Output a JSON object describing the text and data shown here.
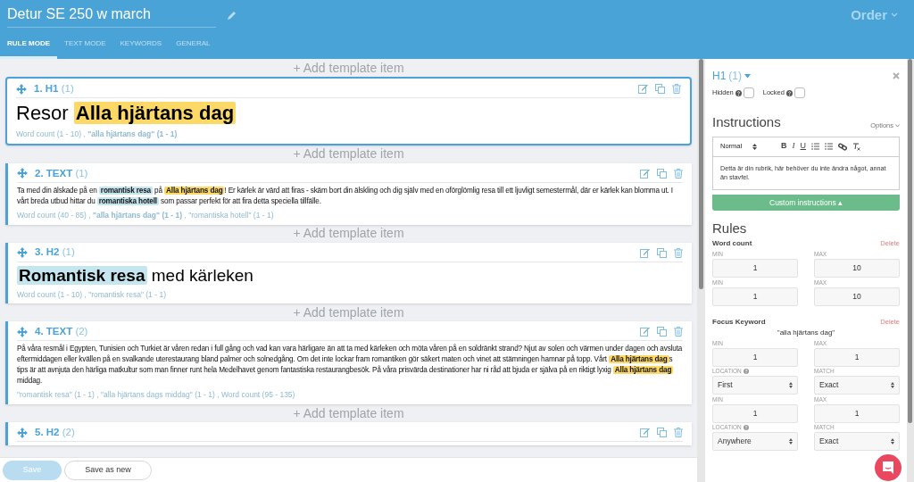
{
  "header": {
    "title": "Detur SE 250 w march",
    "menu": "Order"
  },
  "tabs": [
    {
      "label": "RULE MODE",
      "selected": true
    },
    {
      "label": "TEXT MODE",
      "selected": false
    },
    {
      "label": "KEYWORDS",
      "selected": false
    },
    {
      "label": "GENERAL",
      "selected": false
    }
  ],
  "items": [
    {
      "add_label": "+ Add template item",
      "title": "1. H1",
      "count": "(1)",
      "kind": "h1",
      "selected": true,
      "content": [
        {
          "kind": "plain",
          "text": "Resor "
        },
        {
          "kind": "focus",
          "text": "Alla hjärtans dag"
        }
      ],
      "meta": "Word count (1 - 10) , **\"alla hjärtans dag\" (1 - 1)**"
    },
    {
      "add_label": "+ Add template item",
      "title": "2. TEXT",
      "count": "(1)",
      "kind": "text",
      "selected": false,
      "content": [
        {
          "kind": "plain",
          "text": "Ta med din älskade på en "
        },
        {
          "kind": "keyword",
          "text": "romantisk resa"
        },
        {
          "kind": "plain",
          "text": " på "
        },
        {
          "kind": "focus",
          "text": "Alla hjärtans dag"
        },
        {
          "kind": "plain",
          "text": "! Er kärlek är värd att firas - skäm bort din älskling och dig själv med en oförglömlig resa till ett ljuvligt semestermål, där er kärlek kan blomma ut. I vårt breda utbud hittar du "
        },
        {
          "kind": "keyword",
          "text": "romantiska hotell"
        },
        {
          "kind": "plain",
          "text": " som passar perfekt för att fira detta speciella tillfälle."
        }
      ],
      "meta": "Word count (40 - 85) , **\"alla hjärtans dag\" (1 - 1)** , \"romantiska hotell\" (1 - 1)"
    },
    {
      "add_label": "+ Add template item",
      "title": "3. H2",
      "count": "(1)",
      "kind": "h2",
      "selected": false,
      "content": [
        {
          "kind": "keyword",
          "text": "Romantisk resa"
        },
        {
          "kind": "plain",
          "text": " med kärleken"
        }
      ],
      "meta": "Word count (1 - 10) , \"romantisk resa\" (1 - 1)"
    },
    {
      "add_label": "+ Add template item",
      "title": "4. TEXT",
      "count": "(2)",
      "kind": "text",
      "selected": false,
      "content": [
        {
          "kind": "plain",
          "text": "På våra resmål i Egypten, Tunisien och Turkiet är våren redan i full gång och vad kan vara härligare än att ta med kärleken och möta våren på en soldränkt strand? Njut av solen och värmen under dagen och avsluta eftermiddagen eller kvällen på en svalkande uterestaurang bland palmer och solnedgång. Om det inte lockar fram romantiken gör säkert maten och vinet att stämningen hamnar på topp. Vårt "
        },
        {
          "kind": "focus",
          "text": "Alla hjärtans dag"
        },
        {
          "kind": "plain",
          "text": "s tips är att avnjuta den härliga matkultur som man finner runt hela Medelhavet genom fantastiska restaurangbesök. På våra prisvärda destinationer har ni råd att bjuda er själva på en riktigt lyxig "
        },
        {
          "kind": "focus",
          "text": "Alla hjärtans dag"
        },
        {
          "kind": "plain",
          "text": " middag."
        }
      ],
      "meta": "\"romantisk resa\" (1 - 1) , \"alla hjärtans dags middag\" (1 - 1) , Word count (95 - 135)"
    },
    {
      "add_label": "+ Add template item",
      "title": "5. H2",
      "count": "(2)",
      "selected": false
    }
  ],
  "footer": {
    "save": {
      "label": "Save",
      "disabled": true
    },
    "save_as_new": "Save as new"
  },
  "panel": {
    "title": "H1",
    "count": "(1)",
    "toggles": [
      {
        "label": "Hidden",
        "checked": false
      },
      {
        "label": "Locked",
        "checked": false
      }
    ],
    "instructions_heading": "Instructions",
    "options": "Options",
    "style_select": "Normal",
    "format_buttons": [
      "B",
      "I",
      "U"
    ],
    "instructions_text": "Detta är din rubrik, här behöver du inte ändra något, annat än stavfel.",
    "custom_button": "Custom instructions ▴",
    "rules_heading": "Rules",
    "rules": [
      {
        "kind": "word_count",
        "name": "Word count",
        "delete": "Delete",
        "ranges": [
          {
            "min_label": "MIN",
            "min": "1",
            "max_label": "MAX",
            "max": "10"
          },
          {
            "min_label": "MIN",
            "min": "1",
            "max_label": "MAX",
            "max": "10"
          }
        ]
      },
      {
        "kind": "keyword",
        "name": "Focus Keyword",
        "delete": "Delete",
        "keyword": "\"alla hjärtans dag\"",
        "ranges": [
          {
            "min_label": "MIN",
            "min": "1",
            "max_label": "MAX",
            "max": "1",
            "location_label": "LOCATION",
            "location": "First",
            "match_label": "MATCH",
            "match": "Exact"
          },
          {
            "min_label": "MIN",
            "min": "1",
            "max_label": "MAX",
            "max": "1",
            "location_label": "LOCATION",
            "location": "Anywhere",
            "match_label": "MATCH",
            "match": "Exact"
          }
        ]
      }
    ]
  }
}
